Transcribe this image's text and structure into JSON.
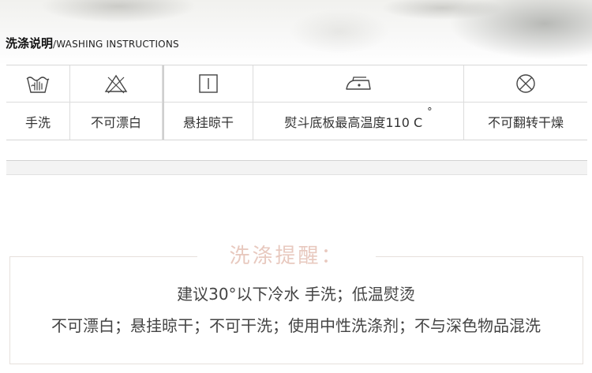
{
  "header": {
    "title_cn": "洗涤说明",
    "separator": "/",
    "title_en": "WASHING INSTRUCTIONS"
  },
  "care_symbols": [
    {
      "icon": "hand-wash-icon",
      "label": "手洗"
    },
    {
      "icon": "no-bleach-icon",
      "label": "不可漂白"
    },
    {
      "icon": "hang-dry-icon",
      "label": "悬挂晾干"
    },
    {
      "icon": "iron-icon",
      "label": "熨斗底板最高温度110 C",
      "suffix": "°"
    },
    {
      "icon": "no-tumble-dry-icon",
      "label": "不可翻转干燥"
    }
  ],
  "reminder": {
    "title": "洗涤提醒：",
    "line1": "建议30°以下冷水 手洗；低温熨烫",
    "line2": "不可漂白；悬挂晾干；不可干洗；使用中性洗涤剂；不与深色物品混洗"
  },
  "colors": {
    "reminder_title": "#e8c9bf",
    "grid_line": "#dcdcdc"
  }
}
